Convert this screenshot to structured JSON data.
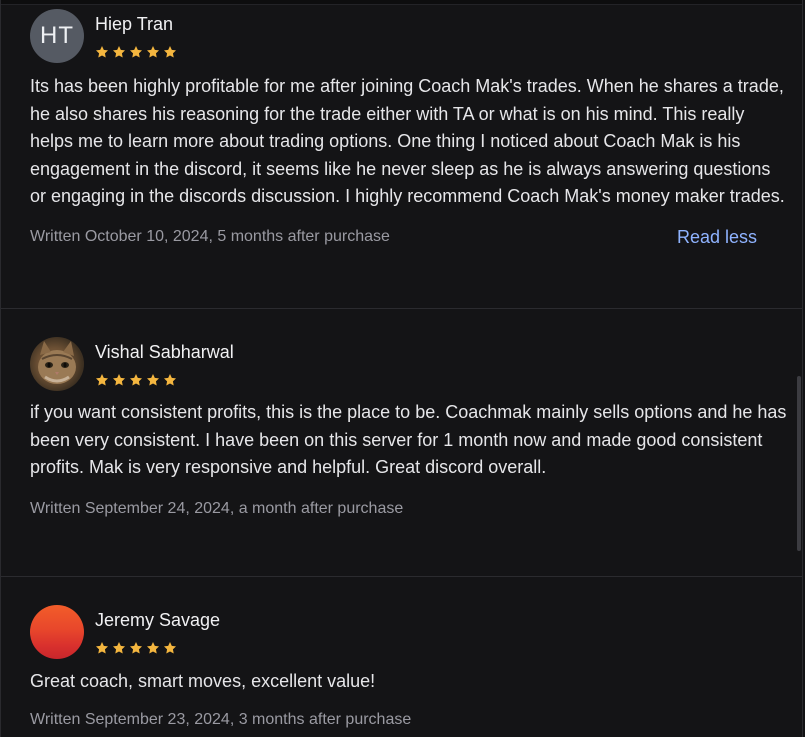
{
  "colors": {
    "star": "#f4b63f",
    "link": "#8fb3ff",
    "background": "#141416"
  },
  "reviews": [
    {
      "avatar_initials": "HT",
      "avatar_type": "initials",
      "name": "Hiep Tran",
      "rating": 5,
      "text": "Its has been highly profitable for me after joining Coach Mak's trades. When he shares a trade, he also shares his reasoning for the trade either with TA or what is on his mind. This really helps me to learn more about trading options. One thing I noticed about Coach Mak is his engagement in the discord, it seems like he never sleep as he is always answering questions or engaging in the discords discussion. I highly recommend Coach Mak's money maker trades.",
      "meta": "Written October 10, 2024, 5 months after purchase",
      "read_less": "Read less"
    },
    {
      "avatar_type": "cat-photo",
      "name": "Vishal Sabharwal",
      "rating": 5,
      "text": "if you want consistent profits, this is the place to be. Coachmak mainly sells options and he has been very consistent. I have been on this server for 1 month now and made good consistent profits. Mak is very responsive and helpful. Great discord overall.",
      "meta": "Written September 24, 2024, a month after purchase"
    },
    {
      "avatar_type": "sunset-gradient",
      "name": "Jeremy Savage",
      "rating": 5,
      "text": "Great coach, smart moves, excellent value!",
      "meta": "Written September 23, 2024, 3 months after purchase"
    }
  ]
}
